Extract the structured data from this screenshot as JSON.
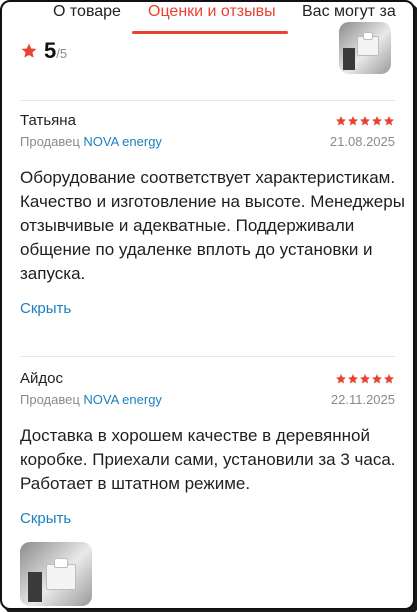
{
  "tabs": [
    {
      "label": "О товаре"
    },
    {
      "label": "Оценки и отзывы"
    },
    {
      "label": "Вас могут за"
    }
  ],
  "summary": {
    "score": "5",
    "scale": "/5",
    "icon": "star-icon",
    "accent": "#e8432f"
  },
  "reviews": [
    {
      "author": "Татьяна",
      "rating": 5,
      "seller_prefix": "Продавец",
      "seller_name": "NOVA energy",
      "date": "21.08.2025",
      "text": "Оборудование соответствует характеристикам. Качество и изготовление на высоте. Менеджеры отзывчивые и адекватные. Поддерживали общение по удаленке вплоть до установки и запуска.",
      "toggle_label": "Скрыть"
    },
    {
      "author": "Айдос",
      "rating": 5,
      "seller_prefix": "Продавец",
      "seller_name": "NOVA energy",
      "date": "22.11.2025",
      "text": "Доставка в хорошем качестве в деревянной коробке. Приехали сами, установили за 3 часа. Работает в штатном режиме.",
      "toggle_label": "Скрыть"
    }
  ]
}
